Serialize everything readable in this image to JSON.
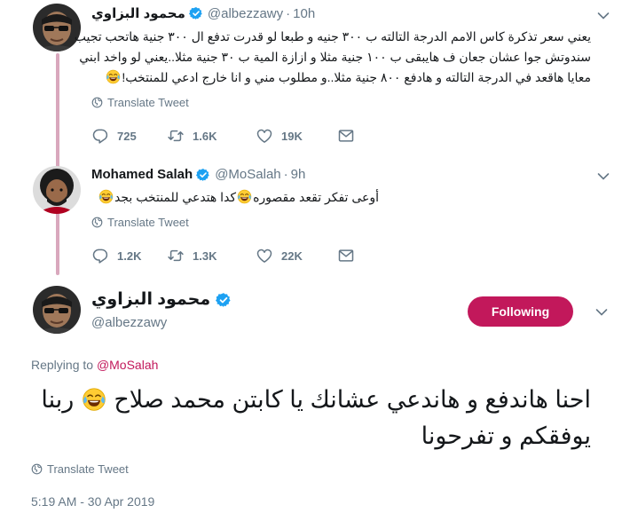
{
  "tweet1": {
    "name": "محمود البزاوي",
    "handle": "@albezzawy",
    "time": "10h",
    "lines": [
      "يعني سعر تذكرة كاس الامم الدرجة التالته ب ٣٠٠ جنيه و طبعا لو قدرت تدفع ال ٣٠٠ جنية هاتحب تجيب",
      "سندوتش جوا عشان جعان ف هايبقى ب ١٠٠ جنية مثلا و ازازة المية ب ٣٠ جنية مثلا..يعني لو واخد ابني",
      "معايا هاقعد في الدرجة التالته و هادفع ٨٠٠ جنية مثلا..و مطلوب مني و انا خارج ادعي للمنتخب!"
    ],
    "translate": "Translate Tweet",
    "replies": "725",
    "retweets": "1.6K",
    "likes": "19K"
  },
  "tweet2": {
    "name": "Mohamed Salah",
    "handle": "@MoSalah",
    "time": "9h",
    "text_a": "أوعى تفكر تقعد مقصوره",
    "text_b": "كدا هتدعي للمنتخب بجد",
    "translate": "Translate Tweet",
    "replies": "1.2K",
    "retweets": "1.3K",
    "likes": "22K"
  },
  "main": {
    "name": "محمود البزاوي",
    "handle": "@albezzawy",
    "follow_label": "Following",
    "replying_prefix": "Replying to",
    "replying_to": "@MoSalah",
    "line1_a": "احنا هاندفع و هاندعي عشانك يا كابتن محمد صلاح",
    "line1_b": "ربنا",
    "line2": "يوفقكم و تفرحونا",
    "translate": "Translate Tweet",
    "timestamp": "5:19 AM - 30 Apr 2019"
  },
  "icons": {
    "verified": "verified-badge-icon",
    "reply": "reply-icon",
    "retweet": "retweet-icon",
    "like": "heart-icon",
    "dm": "envelope-icon",
    "globe": "globe-icon",
    "caret": "chevron-down-icon",
    "emoji": "face-with-tears-of-joy-icon"
  },
  "colors": {
    "accent": "#c2185b",
    "verified": "#1da1f2",
    "thread_line": "#d9a8bd",
    "secondary_text": "#657786"
  }
}
